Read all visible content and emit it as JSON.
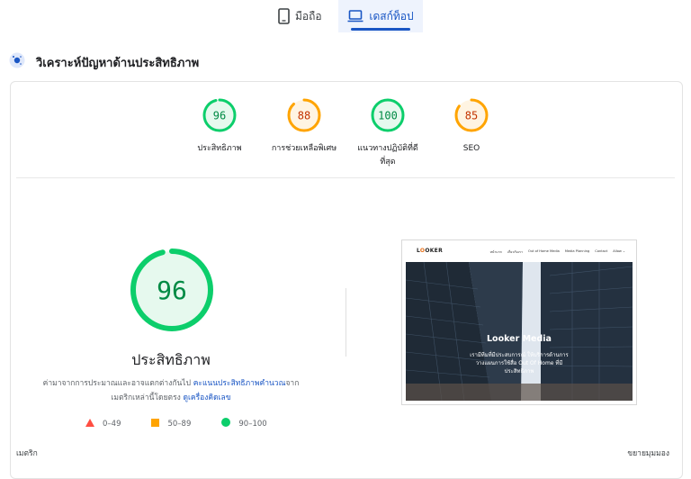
{
  "tabs": [
    {
      "label": "มือถือ",
      "icon": "phone-icon",
      "selected": false
    },
    {
      "label": "เดสก์ท็อป",
      "icon": "laptop-icon",
      "selected": true
    }
  ],
  "analysis": {
    "title": "วิเคราะห์ปัญหาด้านประสิทธิภาพ",
    "icon": "analysis-dot-icon"
  },
  "colors": {
    "pass": "#0cce6b",
    "average": "#ffa400",
    "fail": "#ff4e42",
    "accent": "#1a56c4"
  },
  "scores": [
    {
      "value": "96",
      "label": "ประสิทธิภาพ",
      "rating": "pass"
    },
    {
      "value": "88",
      "label": "การช่วยเหลือพิเศษ",
      "rating": "average"
    },
    {
      "value": "100",
      "label": "แนวทางปฏิบัติที่ดีที่สุด",
      "rating": "pass"
    },
    {
      "value": "85",
      "label": "SEO",
      "rating": "average"
    }
  ],
  "main": {
    "score": "96",
    "title": "ประสิทธิภาพ",
    "desc_1": "ค่ามาจากการประมาณและอาจแตกต่างกันไป ",
    "desc_link_1": "คะแนนประสิทธิภาพคำนวณ",
    "desc_2": "จาก",
    "desc_3": "เมตริกเหล่านี้โดยตรง ",
    "desc_link_2": "ดูเครื่องคิดเลข"
  },
  "legend": [
    {
      "shape": "triangle",
      "range": "0–49",
      "rating": "fail"
    },
    {
      "shape": "square",
      "range": "50–89",
      "rating": "average"
    },
    {
      "shape": "circle",
      "range": "90–100",
      "rating": "pass"
    }
  ],
  "screenshot": {
    "logo_text": "LOOKER",
    "logo_accent": "O",
    "nav": [
      "หน้าแรก",
      "เกี่ยวกับเรา",
      "Out of Home Media",
      "Media Planning",
      "Contact",
      "Allow ⌄"
    ],
    "hero_title": "Looker Media",
    "hero_lines": [
      "เรามีทีมที่มีประสบการณ์ ให้บริการด้านการ",
      "วางแผนการใช้สื่อ Out Of Home ที่มี",
      "ประสิทธิภาพ"
    ]
  },
  "footer": {
    "metrics": "เมตริก",
    "expand": "ขยายมุมมอง"
  }
}
